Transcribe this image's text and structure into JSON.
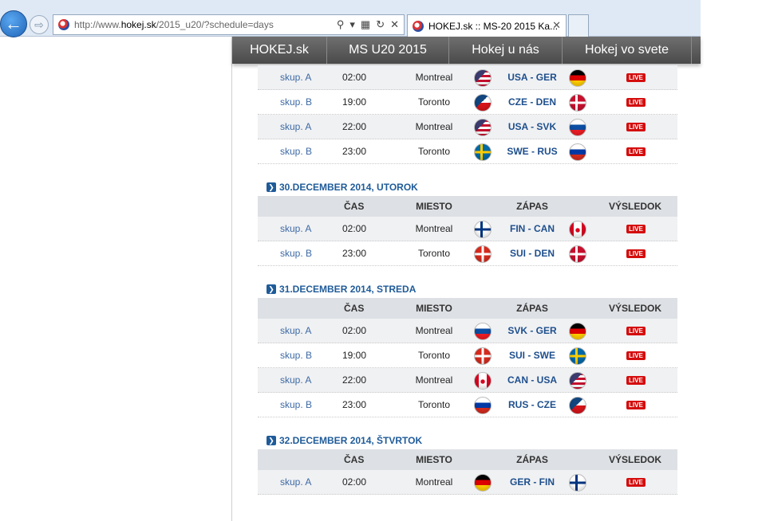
{
  "browser": {
    "url_prefix": "http://www.",
    "url_domain": "hokej.sk",
    "url_path": "/2015_u20/?schedule=days",
    "tab_title": "HOKEJ.sk :: MS-20 2015 Ka...",
    "tab_close": "✕"
  },
  "nav": [
    {
      "label": "HOKEJ.sk"
    },
    {
      "label": "MS U20 2015"
    },
    {
      "label": "Hokej u nás"
    },
    {
      "label": "Hokej vo svete"
    }
  ],
  "columns": {
    "time": "ČAS",
    "place": "MIESTO",
    "match": "ZÁPAS",
    "result": "VÝSLEDOK"
  },
  "live_label": "LIVE",
  "flags": {
    "USA": "#3c3b6e",
    "GER": "#000000",
    "CZE": "#11457e",
    "DEN": "#c8102e",
    "SVK": "#0b4ea2",
    "SWE": "#006aa7",
    "RUS": "#0039a6",
    "FIN": "#003580",
    "CAN": "#d80621",
    "SUI": "#d52b1e"
  },
  "partial_day": {
    "games": [
      {
        "group": "skup. A",
        "time": "02:00",
        "place": "Montreal",
        "home": "USA",
        "away": "GER",
        "match": "USA - GER"
      },
      {
        "group": "skup. B",
        "time": "19:00",
        "place": "Toronto",
        "home": "CZE",
        "away": "DEN",
        "match": "CZE - DEN"
      },
      {
        "group": "skup. A",
        "time": "22:00",
        "place": "Montreal",
        "home": "USA",
        "away": "SVK",
        "match": "USA - SVK"
      },
      {
        "group": "skup. B",
        "time": "23:00",
        "place": "Toronto",
        "home": "SWE",
        "away": "RUS",
        "match": "SWE - RUS"
      }
    ]
  },
  "days": [
    {
      "title": "30.DECEMBER 2014, UTOROK",
      "games": [
        {
          "group": "skup. A",
          "time": "02:00",
          "place": "Montreal",
          "home": "FIN",
          "away": "CAN",
          "match": "FIN - CAN"
        },
        {
          "group": "skup. B",
          "time": "23:00",
          "place": "Toronto",
          "home": "SUI",
          "away": "DEN",
          "match": "SUI - DEN"
        }
      ]
    },
    {
      "title": "31.DECEMBER 2014, STREDA",
      "games": [
        {
          "group": "skup. A",
          "time": "02:00",
          "place": "Montreal",
          "home": "SVK",
          "away": "GER",
          "match": "SVK - GER"
        },
        {
          "group": "skup. B",
          "time": "19:00",
          "place": "Toronto",
          "home": "SUI",
          "away": "SWE",
          "match": "SUI - SWE"
        },
        {
          "group": "skup. A",
          "time": "22:00",
          "place": "Montreal",
          "home": "CAN",
          "away": "USA",
          "match": "CAN - USA"
        },
        {
          "group": "skup. B",
          "time": "23:00",
          "place": "Toronto",
          "home": "RUS",
          "away": "CZE",
          "match": "RUS - CZE"
        }
      ]
    },
    {
      "title": "32.DECEMBER 2014, ŠTVRTOK",
      "games": [
        {
          "group": "skup. A",
          "time": "02:00",
          "place": "Montreal",
          "home": "GER",
          "away": "FIN",
          "match": "GER - FIN"
        }
      ]
    }
  ]
}
